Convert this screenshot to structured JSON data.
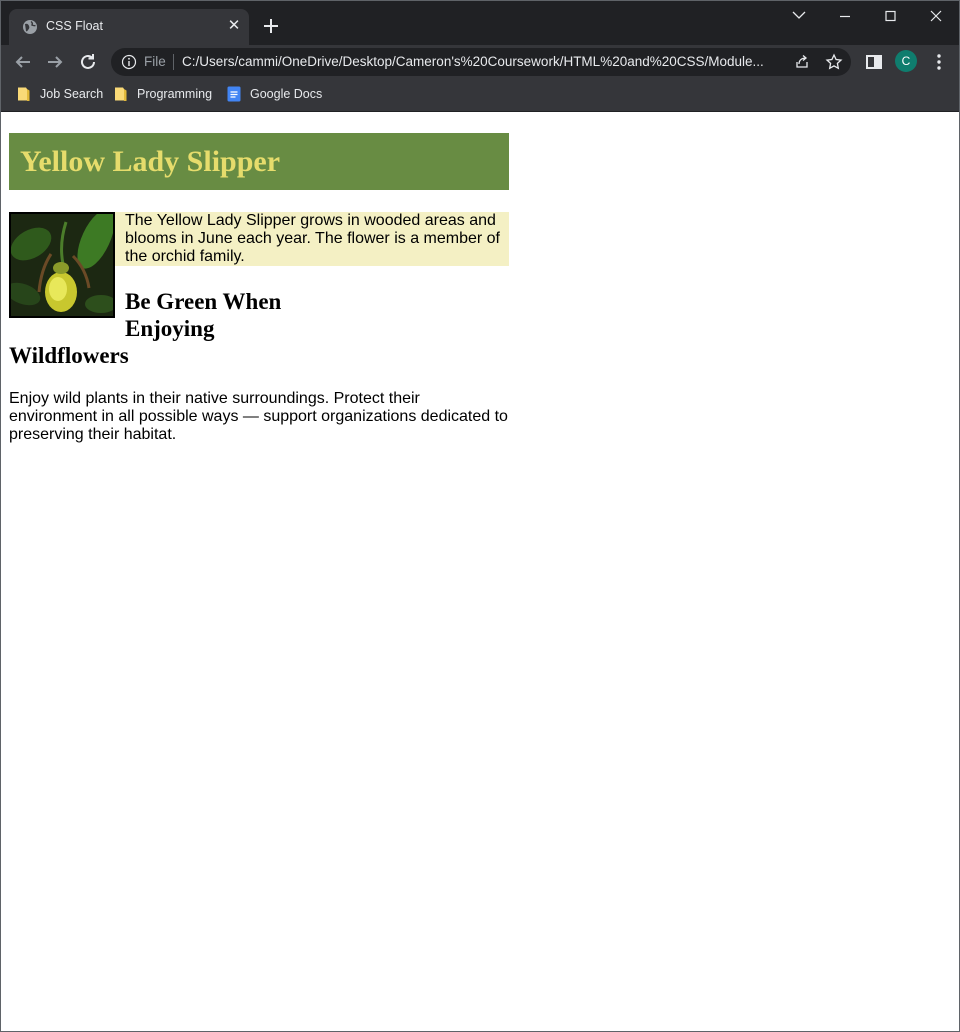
{
  "browser": {
    "tab": {
      "title": "CSS Float",
      "icon": "globe-icon"
    },
    "address_bar": {
      "scheme_label": "File",
      "url": "C:/Users/cammi/OneDrive/Desktop/Cameron's%20Coursework/HTML%20and%20CSS/Module..."
    },
    "profile_initial": "C",
    "bookmarks": [
      {
        "label": "Job Search",
        "icon": "folder-icon"
      },
      {
        "label": "Programming",
        "icon": "folder-icon"
      },
      {
        "label": "Google Docs",
        "icon": "google-docs-icon"
      }
    ]
  },
  "page": {
    "heading": "Yellow Lady Slipper",
    "intro": "The Yellow Lady Slipper grows in wooded areas and blooms in June each year. The flower is a member of the orchid family.",
    "subheading": "Be Green When Enjoying Wildflowers",
    "closing": "Enjoy wild plants in their native surroundings. Protect their environment in all possible ways — support organizations dedicated to preserving their habitat."
  },
  "colors": {
    "heading_bg": "#688c43",
    "heading_text": "#e6dc6c",
    "intro_bg": "#f4f0c4",
    "chrome_dark": "#202124",
    "chrome_toolbar": "#35363a"
  }
}
